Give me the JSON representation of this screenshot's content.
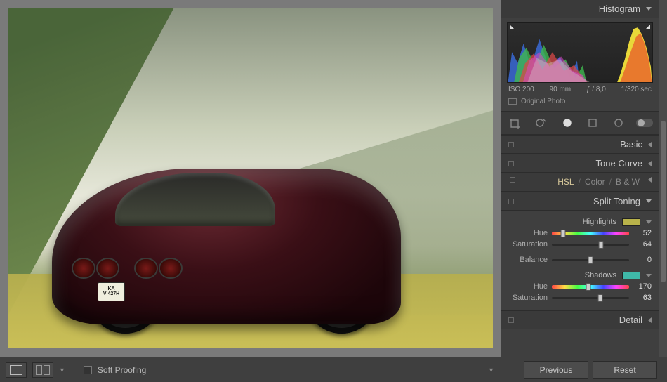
{
  "histogram": {
    "title": "Histogram",
    "iso": "ISO 200",
    "focal": "90 mm",
    "aperture": "ƒ / 8,0",
    "shutter": "1/320 sec",
    "original_photo": "Original Photo"
  },
  "panels": {
    "basic": "Basic",
    "tone_curve": "Tone Curve",
    "hsl": "HSL",
    "color": "Color",
    "bw": "B & W",
    "split_toning": "Split Toning",
    "detail": "Detail"
  },
  "split_toning": {
    "highlights_label": "Highlights",
    "highlights_swatch": "#b8b24a",
    "hue_label": "Hue",
    "saturation_label": "Saturation",
    "balance_label": "Balance",
    "shadows_label": "Shadows",
    "shadows_swatch": "#3fb8a8",
    "highlights_hue": "52",
    "highlights_sat": "64",
    "balance": "0",
    "shadows_hue": "170",
    "shadows_sat": "63"
  },
  "bottom": {
    "soft_proofing": "Soft Proofing",
    "previous": "Previous",
    "reset": "Reset"
  },
  "plate": {
    "line1": "KA",
    "line2": "V 427H"
  }
}
